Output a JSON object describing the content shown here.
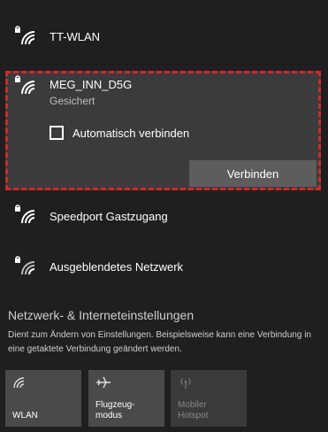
{
  "networks": {
    "tt_wlan": {
      "name": "TT-WLAN"
    },
    "selected": {
      "name": "MEG_INN_D5G",
      "status": "Gesichert",
      "auto_connect_label": "Automatisch verbinden",
      "connect_label": "Verbinden"
    },
    "speedport": {
      "name": "Speedport Gastzugang"
    },
    "hidden": {
      "name": "Ausgeblendetes Netzwerk"
    }
  },
  "settings": {
    "title": "Netzwerk- & Interneteinstellungen",
    "description": "Dient zum Ändern von Einstellungen. Beispielsweise kann eine Verbindung in eine getaktete Verbindung geändert werden."
  },
  "quick_actions": {
    "wlan": {
      "label": "WLAN",
      "icon": "wifi-icon"
    },
    "flight": {
      "label_line1": "Flugzeug-",
      "label_line2": "modus",
      "icon": "airplane-icon"
    },
    "hotspot": {
      "label_line1": "Mobiler",
      "label_line2": "Hotspot",
      "icon": "hotspot-icon"
    }
  },
  "colors": {
    "background": "#1f1f1f",
    "selected_bg": "#3b3b3b",
    "highlight_border": "#d62626",
    "tile_active": "#4a4a4a",
    "tile_disabled": "#3a3a3a"
  }
}
